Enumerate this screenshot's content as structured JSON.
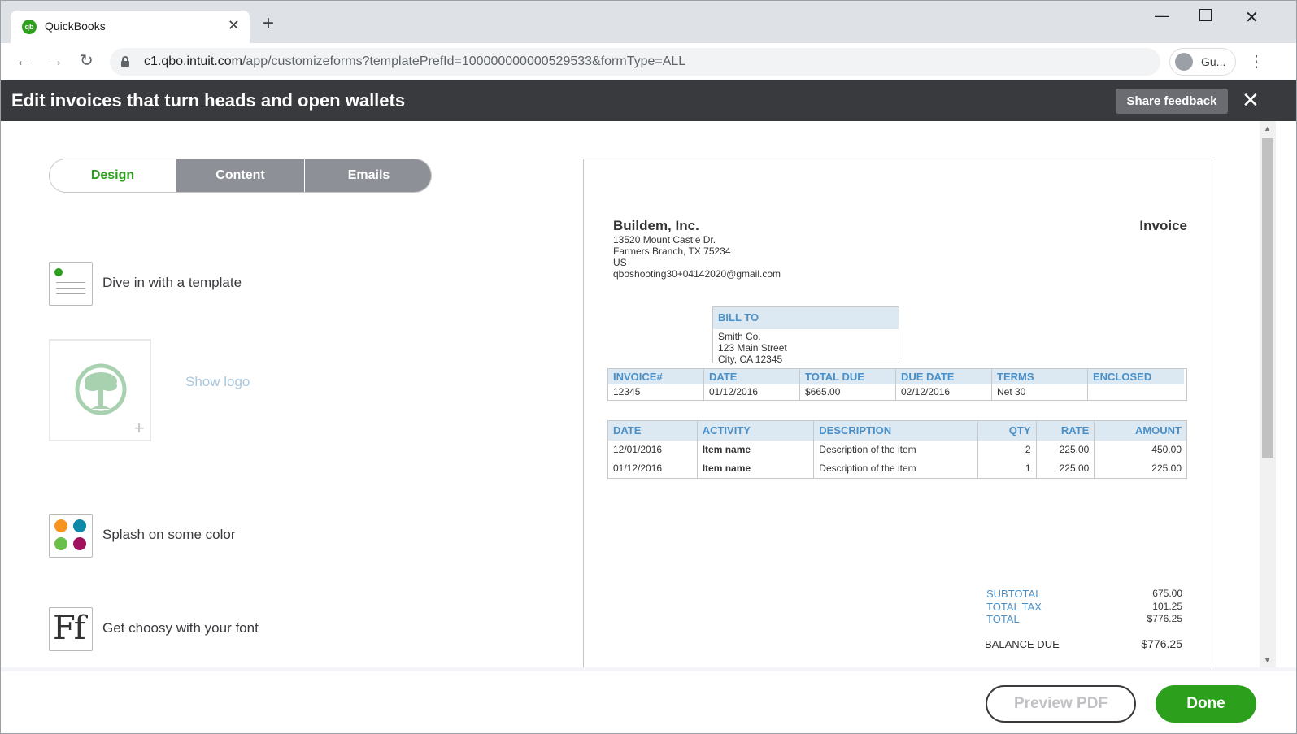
{
  "browser": {
    "tab_title": "QuickBooks",
    "favicon_text": "qb",
    "url_host": "c1.qbo.intuit.com",
    "url_path": "/app/customizeforms?templatePrefId=100000000000529533&formType=ALL",
    "profile_label": "Gu..."
  },
  "header": {
    "title": "Edit invoices that turn heads and open wallets",
    "share_feedback": "Share feedback"
  },
  "tabs": {
    "design": "Design",
    "content": "Content",
    "emails": "Emails"
  },
  "options": {
    "template": "Dive in with a template",
    "show_logo": "Show logo",
    "color": "Splash on some color",
    "font": "Get choosy with your font",
    "font_glyph": "Ff",
    "colors": [
      "#f7941d",
      "#0e8aa8",
      "#6abf4b",
      "#a0115e"
    ]
  },
  "invoice": {
    "company_name": "Buildem, Inc.",
    "company_lines": [
      "13520 Mount Castle Dr.",
      "Farmers Branch, TX 75234",
      "US",
      "qboshooting30+04142020@gmail.com"
    ],
    "title": "Invoice",
    "bill_to_label": "BILL TO",
    "bill_to_lines": [
      "Smith Co.",
      "123 Main Street",
      "City, CA 12345"
    ],
    "meta_headers": [
      "INVOICE#",
      "DATE",
      "TOTAL DUE",
      "DUE DATE",
      "TERMS",
      "ENCLOSED"
    ],
    "meta_values": [
      "12345",
      "01/12/2016",
      "$665.00",
      "02/12/2016",
      "Net 30",
      ""
    ],
    "item_headers": [
      "DATE",
      "ACTIVITY",
      "DESCRIPTION",
      "QTY",
      "RATE",
      "AMOUNT"
    ],
    "items": [
      [
        "12/01/2016",
        "Item name",
        "Description of the item",
        "2",
        "225.00",
        "450.00"
      ],
      [
        "01/12/2016",
        "Item name",
        "Description of the item",
        "1",
        "225.00",
        "225.00"
      ]
    ],
    "subtotal_label": "SUBTOTAL",
    "subtotal": "675.00",
    "tax_label": "TOTAL TAX",
    "tax": "101.25",
    "total_label": "TOTAL",
    "total": "$776.25",
    "balance_label": "BALANCE DUE",
    "balance": "$776.25"
  },
  "footer": {
    "preview_pdf": "Preview PDF",
    "done": "Done"
  }
}
